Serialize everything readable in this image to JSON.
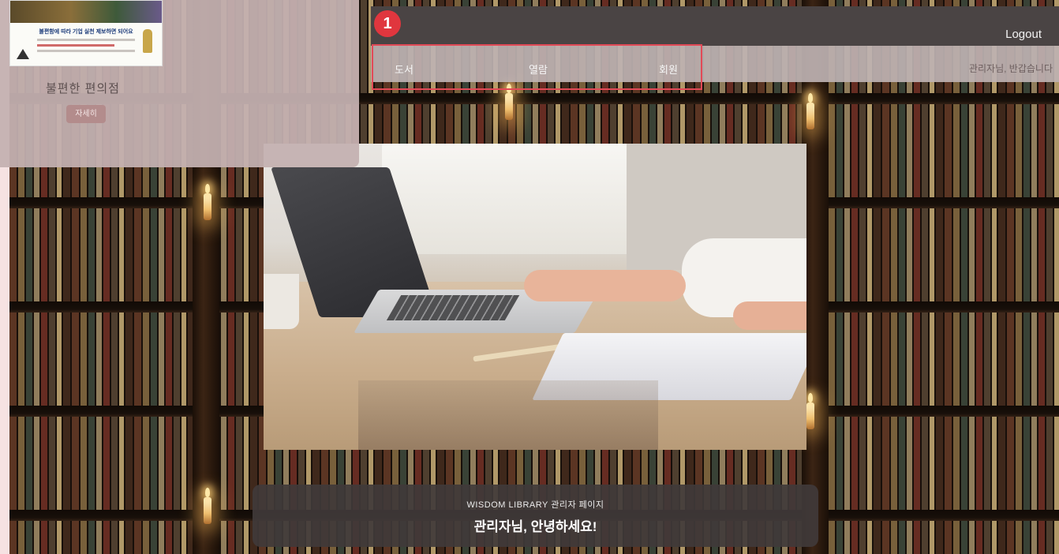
{
  "header": {
    "step_marker": "1",
    "logout_label": "Logout",
    "greeting_short": "관리자님, 반갑습니다"
  },
  "nav": {
    "items": [
      "도서",
      "열람",
      "회원"
    ]
  },
  "popup": {
    "notice_heading": "불편함에 따라 기업 실천 제보하면 되어요",
    "title": "불편한 편의점",
    "button_label": "자세히"
  },
  "banner": {
    "subtitle": "WISDOM LIBRARY 관리자 페이지",
    "title": "관리자님, 안녕하세요!"
  },
  "colors": {
    "highlight": "#e24a57",
    "header_bg": "#4a4444",
    "popup_bg": "#c4b0b0",
    "popup_button": "#b38c8c"
  }
}
